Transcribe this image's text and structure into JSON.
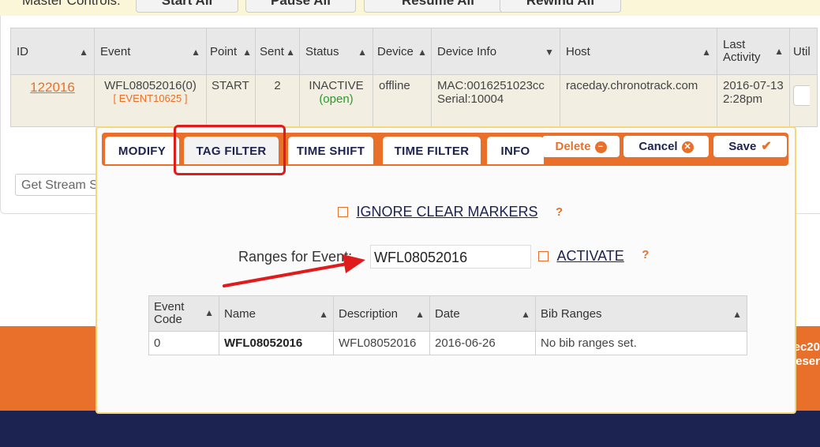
{
  "master_controls": {
    "label": "Master Controls:",
    "buttons": [
      "Start All",
      "Pause All",
      "Resume All",
      "Rewind All"
    ]
  },
  "main_table": {
    "columns": [
      "ID",
      "Event",
      "Point",
      "Sent",
      "Status",
      "Device",
      "Device Info",
      "Host",
      "Last Activity",
      "Util"
    ],
    "row": {
      "id": "122016",
      "event": "WFL08052016(0)",
      "event_sub": "[ EVENT10625 ]",
      "point": "START",
      "sent": "2",
      "status": "INACTIVE",
      "status_sub": "(open)",
      "device": "offline",
      "device_info_mac": "MAC:0016251023cc",
      "device_info_serial": "Serial:10004",
      "host": "raceday.chronotrack.com",
      "last_activity": "2016-07-13 2:28pm"
    }
  },
  "stream_select": {
    "value": "Get Stream S"
  },
  "modal": {
    "tabs": [
      "MODIFY",
      "TAG FILTER",
      "TIME SHIFT",
      "TIME FILTER",
      "INFO"
    ],
    "active_tab": "TAG FILTER",
    "actions": {
      "delete": "Delete",
      "cancel": "Cancel",
      "save": "Save"
    },
    "ignore_clear_markers": "IGNORE CLEAR MARKERS",
    "ranges_label": "Ranges for Event:",
    "ranges_value": "WFL08052016",
    "activate": "ACTIVATE",
    "help": "?",
    "inner_table": {
      "columns": [
        "Event Code",
        "Name",
        "Description",
        "Date",
        "Bib Ranges"
      ],
      "row": {
        "code": "0",
        "name": "WFL08052016",
        "description": "WFL08052016",
        "date": "2016-06-26",
        "bib_ranges": "No bib ranges set."
      }
    }
  },
  "footer": {
    "line1": "ec20",
    "line2": "eser"
  },
  "colors": {
    "accent": "#e8702a",
    "navy": "#1c2350",
    "highlight": "#e01b1b",
    "panel_border": "#f5d77a"
  }
}
